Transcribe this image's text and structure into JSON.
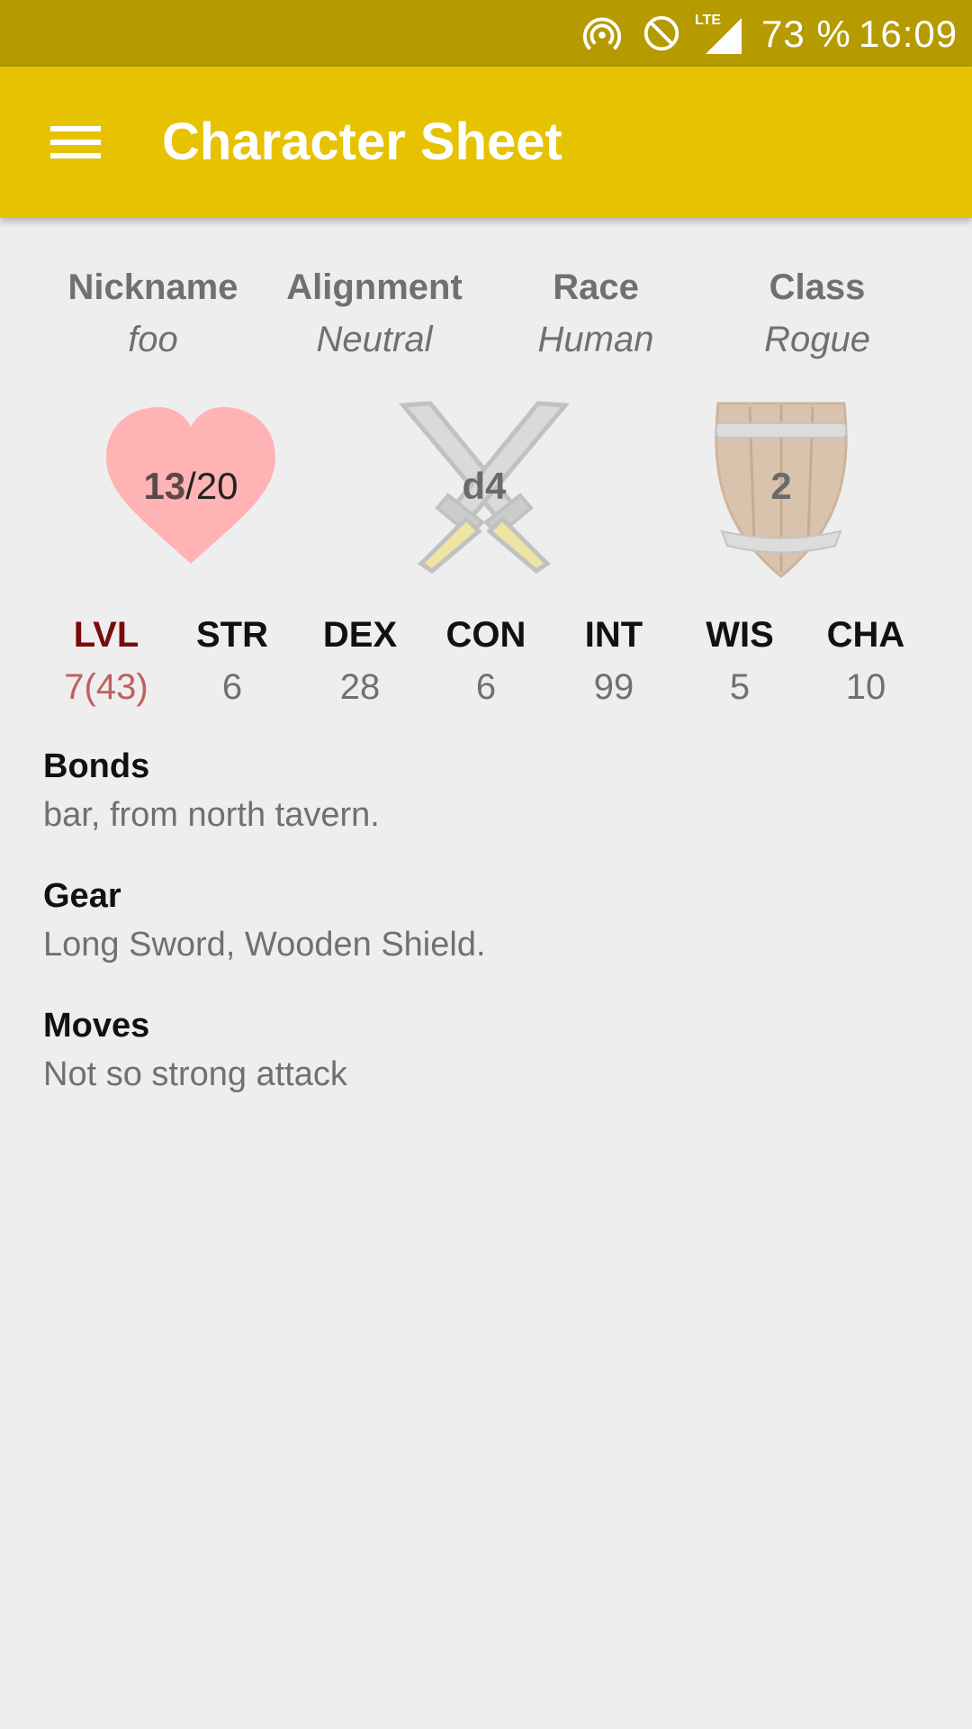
{
  "status_bar": {
    "icons": [
      "hotspot-icon",
      "do-not-disturb-icon",
      "lte-signal-icon"
    ],
    "lte_label": "LTE",
    "battery": "73 %",
    "time": "16:09"
  },
  "app_bar": {
    "title": "Character Sheet",
    "menu_icon": "hamburger-menu-icon"
  },
  "info": {
    "nickname": {
      "label": "Nickname",
      "value": "foo"
    },
    "alignment": {
      "label": "Alignment",
      "value": "Neutral"
    },
    "race": {
      "label": "Race",
      "value": "Human"
    },
    "class": {
      "label": "Class",
      "value": "Rogue"
    }
  },
  "emblems": {
    "hp": {
      "icon": "heart-icon",
      "current": "13",
      "separator": "/",
      "max": "20"
    },
    "damage": {
      "icon": "crossed-swords-icon",
      "value": "d4"
    },
    "armor": {
      "icon": "wooden-shield-icon",
      "value": "2"
    }
  },
  "stats": {
    "lvl": {
      "label": "LVL",
      "value": "7(43)"
    },
    "str": {
      "label": "STR",
      "value": "6"
    },
    "dex": {
      "label": "DEX",
      "value": "28"
    },
    "con": {
      "label": "CON",
      "value": "6"
    },
    "int": {
      "label": "INT",
      "value": "99"
    },
    "wis": {
      "label": "WIS",
      "value": "5"
    },
    "cha": {
      "label": "CHA",
      "value": "10"
    }
  },
  "sections": {
    "bonds": {
      "title": "Bonds",
      "body": "bar, from north tavern."
    },
    "gear": {
      "title": "Gear",
      "body": "Long Sword, Wooden Shield."
    },
    "moves": {
      "title": "Moves",
      "body": "Not so strong attack"
    }
  },
  "colors": {
    "status_bar": "#b59a00",
    "app_bar": "#e6c200",
    "background": "#eeeeef",
    "lvl_label": "#7a0b0b",
    "lvl_value": "#c0605e",
    "heart": "#ffb3b5"
  }
}
